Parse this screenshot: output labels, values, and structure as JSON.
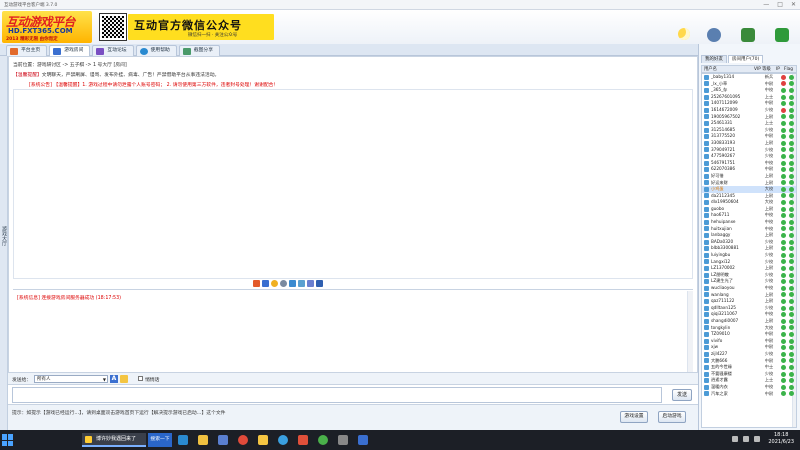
{
  "window": {
    "title": "互动游戏平台客户端 3.7.0",
    "controls": [
      "—",
      "□",
      "✕"
    ]
  },
  "header": {
    "logo_line1": "互动游戏平台",
    "logo_line2": "HD.FXT365.COM",
    "logo_line3": "2013 精彩无限 由你而定",
    "wechat_title": "互动官方微信公众号",
    "wechat_sub": "微信扫一扫 · 关注公众号",
    "actions": [
      {
        "label": "系统设置",
        "icon": "gear-icon",
        "color": "#5a7fb0"
      },
      {
        "label": "访问官网",
        "icon": "home-icon",
        "color": "#3a8a3a"
      },
      {
        "label": "退出平台",
        "icon": "exit-icon",
        "color": "#2f9a3a"
      }
    ]
  },
  "tabs": [
    {
      "label": "平台主页",
      "icon": "home-icon",
      "color": "#e26a2c",
      "active": false
    },
    {
      "label": "游戏房间",
      "icon": "game-icon",
      "color": "#3a6fd0",
      "active": true
    },
    {
      "label": "互动论坛",
      "icon": "forum-icon",
      "color": "#7a4fc2",
      "active": false
    },
    {
      "label": "使用帮助",
      "icon": "help-icon",
      "color": "#2a8ad0",
      "active": false
    },
    {
      "label": "截图分享",
      "icon": "image-icon",
      "color": "#4a9a6a",
      "active": false
    }
  ],
  "side_strip_label": "游戏大厅",
  "main": {
    "location": "当前位置：游戏研讨区 -> 五子棋 -> 1 号大厅 [房间]",
    "notice_prefix": "【温馨提醒】",
    "notice_text": "文明聊天，严禁刷屏、谩骂、发布外挂、病毒、广告！严禁借助平台从事违法活动。",
    "system_note": "[系统公告] 【温馨提醒】1. 游戏过程中请勿泄露个人账号密码；  2. 请勿使用第三方软件，违者封号处理！谢谢配合！",
    "system_message": "[系统信息] 连接游戏房间服务器成功 (18:17:53)",
    "send_label": "发送给：",
    "send_target": "所有人",
    "checkbox_label": "悄悄话",
    "send_button": "发送",
    "tip": "提示：如提示【游戏已经运行…】，请到桌面双击游戏首页下运行【解决提示游戏已启动…】这个文件",
    "btn_settings": "游戏设置",
    "btn_start": "启动游戏"
  },
  "right": {
    "tabs": [
      "我的好友",
      "房间用户(70)"
    ],
    "columns": [
      "用户名",
      "VIP 等级",
      "IP",
      "Flag"
    ],
    "users": [
      {
        "name": "_baby1314",
        "rank": "新兵",
        "flag": "#e04040"
      },
      {
        "name": "_lx_小草",
        "rank": "中尉",
        "flag": "#e04040"
      },
      {
        "name": "_365_存",
        "rank": "中校",
        "flag": "#3bb34a"
      },
      {
        "name": "25267601095",
        "rank": "上士",
        "flag": "#3bb34a"
      },
      {
        "name": "1407112099",
        "rank": "中尉",
        "flag": "#3bb34a"
      },
      {
        "name": "1614672009",
        "rank": "少校",
        "flag": "#e04040"
      },
      {
        "name": "19005967502",
        "rank": "上尉",
        "flag": "#3bb34a"
      },
      {
        "name": "25461331",
        "rank": "上士",
        "flag": "#3bb34a"
      },
      {
        "name": "312514685",
        "rank": "少校",
        "flag": "#3bb34a"
      },
      {
        "name": "313775520",
        "rank": "中尉",
        "flag": "#3bb34a"
      },
      {
        "name": "330833193",
        "rank": "上尉",
        "flag": "#3bb34a"
      },
      {
        "name": "379049721",
        "rank": "少校",
        "flag": "#3bb34a"
      },
      {
        "name": "477590267",
        "rank": "少校",
        "flag": "#3bb34a"
      },
      {
        "name": "546791751",
        "rank": "中校",
        "flag": "#3bb34a"
      },
      {
        "name": "622070386",
        "rank": "中尉",
        "flag": "#3bb34a"
      },
      {
        "name": "好可借",
        "rank": "上尉",
        "flag": "#3bb34a"
      },
      {
        "name": "好运来财",
        "rank": "上尉",
        "flag": "#3bb34a"
      },
      {
        "name": "小鸡蛋",
        "rank": "大校",
        "flag": "#3bb34a",
        "highlight": true
      },
      {
        "name": "da2112345",
        "rank": "上尉",
        "flag": "#3bb34a"
      },
      {
        "name": "dlx19950604",
        "rank": "大校",
        "flag": "#3bb34a"
      },
      {
        "name": "guobo",
        "rank": "上尉",
        "flag": "#3bb34a"
      },
      {
        "name": "hao6711",
        "rank": "中校",
        "flag": "#3bb34a"
      },
      {
        "name": "hehuipanxe",
        "rank": "中校",
        "flag": "#3bb34a"
      },
      {
        "name": "huitxujian",
        "rank": "中校",
        "flag": "#3bb34a"
      },
      {
        "name": "lanbaggy",
        "rank": "上尉",
        "flag": "#3bb34a"
      },
      {
        "name": "BADa0320",
        "rank": "少校",
        "flag": "#3bb34a"
      },
      {
        "name": "blbb3300881",
        "rank": "上尉",
        "flag": "#3bb34a"
      },
      {
        "name": "luiyingbu",
        "rank": "少校",
        "flag": "#3bb34a"
      },
      {
        "name": "Langxi12",
        "rank": "少校",
        "flag": "#3bb34a"
      },
      {
        "name": "LZ1370002",
        "rank": "上尉",
        "flag": "#3bb34a"
      },
      {
        "name": "LZ朋明敬",
        "rank": "少校",
        "flag": "#3bb34a"
      },
      {
        "name": "LZ建生光了",
        "rank": "少校",
        "flag": "#3bb34a"
      },
      {
        "name": "wucliaoyou",
        "rank": "中校",
        "flag": "#3bb34a"
      },
      {
        "name": "wanlang",
        "rank": "上尉",
        "flag": "#3bb34a"
      },
      {
        "name": "qaz711122",
        "rank": "上尉",
        "flag": "#3bb34a"
      },
      {
        "name": "qdlltaxn125",
        "rank": "少校",
        "flag": "#3bb34a"
      },
      {
        "name": "qiqi3211067",
        "rank": "中校",
        "flag": "#3bb34a"
      },
      {
        "name": "shangdi0007",
        "rank": "上尉",
        "flag": "#3bb34a"
      },
      {
        "name": "tongkylin",
        "rank": "大校",
        "flag": "#3bb34a"
      },
      {
        "name": "TZ09010",
        "rank": "中尉",
        "flag": "#3bb34a"
      },
      {
        "name": "vivifo",
        "rank": "中尉",
        "flag": "#3bb34a"
      },
      {
        "name": "xjw",
        "rank": "中尉",
        "flag": "#3bb34a"
      },
      {
        "name": "zijl4227",
        "rank": "少校",
        "flag": "#3bb34a"
      },
      {
        "name": "大鹏666",
        "rank": "中尉",
        "flag": "#3bb34a"
      },
      {
        "name": "五的今世缘",
        "rank": "中士",
        "flag": "#3bb34a"
      },
      {
        "name": "不要骚康楼",
        "rank": "少校",
        "flag": "#3bb34a"
      },
      {
        "name": "逍遥才露",
        "rank": "上士",
        "flag": "#3bb34a"
      },
      {
        "name": "温暖内衣",
        "rank": "中校",
        "flag": "#3bb34a"
      },
      {
        "name": "汽车之家",
        "rank": "中尉",
        "flag": "#3bb34a"
      }
    ]
  },
  "taskbar": {
    "window_label": "博许妙我遇回来了",
    "search_label": "搜索一下",
    "time": "18:18",
    "date": "2021/6/23"
  }
}
